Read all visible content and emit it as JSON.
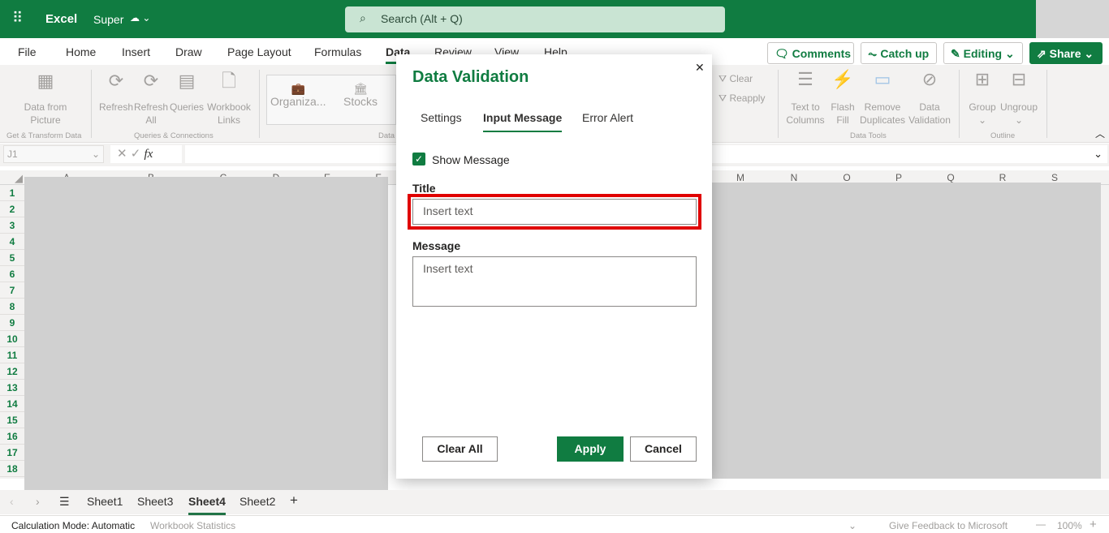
{
  "app": {
    "name": "Excel",
    "file_name": "Super",
    "search_placeholder": "Search (Alt + Q)"
  },
  "menu_tabs": [
    "File",
    "Home",
    "Insert",
    "Draw",
    "Page Layout",
    "Formulas",
    "Data",
    "Review",
    "View",
    "Help"
  ],
  "active_tab": "Data",
  "header_buttons": {
    "comments": "Comments",
    "catch_up": "Catch up",
    "editing": "Editing",
    "share": "Share"
  },
  "ribbon": {
    "get_transform": {
      "data_from_picture": [
        "Data from",
        "Picture"
      ],
      "group": "Get & Transform Data"
    },
    "queries": {
      "refresh": "Refresh",
      "refresh_all": [
        "Refresh",
        "All"
      ],
      "queries": "Queries",
      "workbook_links": [
        "Workbook",
        "Links"
      ],
      "group": "Queries & Connections"
    },
    "data_types": {
      "organization": "Organiza...",
      "stocks": "Stocks",
      "group": "Data"
    },
    "sort_filter": {
      "clear": "Clear",
      "reapply": "Reapply"
    },
    "data_tools": {
      "text_to_columns": [
        "Text to",
        "Columns"
      ],
      "flash_fill": [
        "Flash",
        "Fill"
      ],
      "remove_duplicates": [
        "Remove",
        "Duplicates"
      ],
      "data_validation": [
        "Data",
        "Validation"
      ],
      "group": "Data Tools"
    },
    "outline": {
      "group_btn": "Group",
      "ungroup": "Ungroup",
      "group": "Outline"
    }
  },
  "formula_bar": {
    "name_box": "J1",
    "fx": "fx"
  },
  "columns_left": [
    "A",
    "B",
    "C",
    "D",
    "E",
    "F"
  ],
  "columns_right": [
    "M",
    "N",
    "O",
    "P",
    "Q",
    "R",
    "S"
  ],
  "rows": [
    "1",
    "2",
    "3",
    "4",
    "5",
    "6",
    "7",
    "8",
    "9",
    "10",
    "11",
    "12",
    "13",
    "14",
    "15",
    "16",
    "17",
    "18"
  ],
  "dialog": {
    "title": "Data Validation",
    "tabs": [
      "Settings",
      "Input Message",
      "Error Alert"
    ],
    "active_tab": "Input Message",
    "show_message_label": "Show Message",
    "show_message_checked": true,
    "title_label": "Title",
    "title_placeholder": "Insert text",
    "message_label": "Message",
    "message_placeholder": "Insert text",
    "clear_all": "Clear All",
    "apply": "Apply",
    "cancel": "Cancel"
  },
  "sheets": [
    "Sheet1",
    "Sheet3",
    "Sheet4",
    "Sheet2"
  ],
  "active_sheet": "Sheet4",
  "status": {
    "calc_mode": "Calculation Mode: Automatic",
    "workbook_stats": "Workbook Statistics",
    "feedback": "Give Feedback to Microsoft",
    "zoom": "100%"
  },
  "colors": {
    "brand": "#107c41",
    "highlight": "#e00000"
  }
}
